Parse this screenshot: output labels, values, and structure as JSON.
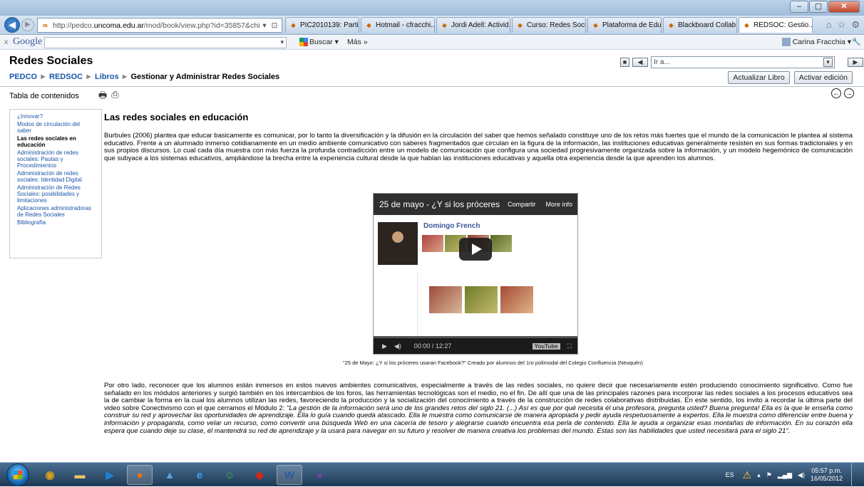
{
  "browser": {
    "address_url_path": "http://pedco.",
    "address_domain": "uncoma.edu.ar",
    "address_rest": "/mod/book/view.php?id=35857&chi",
    "address_controls": "▾ ⊡ C ✕",
    "tabs": [
      {
        "label": "PIC2010139: Partici...",
        "active": false
      },
      {
        "label": "Hotmail - cfracchi...",
        "active": false
      },
      {
        "label": "Jordi Adell: Activid...",
        "active": false
      },
      {
        "label": "Curso: Redes Social...",
        "active": false
      },
      {
        "label": "Plataforma de Edu...",
        "active": false
      },
      {
        "label": "Blackboard Collab...",
        "active": false
      },
      {
        "label": "REDSOC: Gestio...",
        "active": true
      }
    ]
  },
  "google_toolbar": {
    "logo": "Google",
    "buscar": "Buscar ▾",
    "mas": "Más »",
    "user": "Carina Fracchia ▾"
  },
  "page": {
    "site_name": "Redes Sociales",
    "jump_placeholder": "Ir a...",
    "breadcrumb": {
      "items": [
        "PEDCO",
        "REDSOC",
        "Libros"
      ],
      "separator": "►",
      "current": "Gestionar y Administrar Redes Sociales"
    },
    "buttons": {
      "update_book": "Actualizar Libro",
      "edit_mode": "Activar edición"
    },
    "toc_title": "Tabla de contenidos",
    "toc": [
      {
        "label": "¿Innovar?",
        "current": false
      },
      {
        "label": "Modos de circulación del saber",
        "current": false
      },
      {
        "label": "Las redes sociales en educación",
        "current": true
      },
      {
        "label": "Administración de redes sociales: Pautas y Procedimientos",
        "current": false
      },
      {
        "label": "Administración de redes sociales: Identidad Digital",
        "current": false
      },
      {
        "label": "Administración de Redes Sociales: posibilidades y limitaciones",
        "current": false
      },
      {
        "label": "Aplicaciones administradoras de Redes Sociales",
        "current": false
      },
      {
        "label": "Bibliografía",
        "current": false
      }
    ],
    "section_title": "Las redes sociales en educación",
    "paragraph1": "Burbules (2006) plantea que educar basicamente es comunicar, por lo tanto la diversificación y la difusión en la circulación del saber que hemos señalado constituye uno de los retos más fuertes que el mundo de la comunicación le plantea al sistema educativo. Frente a un alumnado inmerso cotidianamente en un medio ambiente comunicativo con saberes fragmentados que circulan en la figura de la información, las instituciones educativas generalmente resisten en sus formas tradicionales y en sus propios discursos. Lo cual cada día muestra con más fuerza la profunda contradicción entre un modelo de comunicación que configura una sociedad progresivamente organizada sobre la información, y un modelo hegemónico de comunicación que subyace a los sistemas educativos, ampliándose la brecha entre la experiencia cultural desde la que hablan las instituciones educativas y aquella otra experiencia desde la que aprenden los alumnos.",
    "video": {
      "title": "25 de mayo - ¿Y si los próceres...",
      "share": "Compartir",
      "more_info": "More info",
      "fb_name": "Domingo French",
      "time": "00:00 / 12:27",
      "yt": "YouTube"
    },
    "caption": "\"25 de Mayo: ¿Y si los próceres usaran Facebook?\" Creado por alumnos del 1ro polimodal del Colegio Confluencia (Neuquén)",
    "paragraph2_plain": "Por otro lado, reconocer que los alumnos están inmersos en estos nuevos ambientes comunicativos, especialmente a través de las redes sociales, no quiere decir que necesariamente estén produciendo conocimiento significativo. Como fue señalado en los módulos anteriores y surgió también en los intercambios de los foros, las herramientas tecnológicas son el medio, no el fin. De allí que una de las principales razones para incorporar las redes sociales a los procesos educativos sea la de cambiar la forma en la cual los alumnos utilizan las redes, favoreciendo la producción y la socialización del conocimiento a través de la construcción de redes colaborativas distribuidas. En este sentido, los invito a recordar la última parte del video sobre Conectivismo con el que cerramos el Módulo 2: ",
    "paragraph2_quote": "\"La gestión de la información será uno de los grandes retos del siglo 21. (...) Así es que por qué necesita él una profesora, pregunta usted? Buena pregunta! Ella es la que le enseña como construir su red y aprovechar las oportunidades de aprendizaje. Ella lo guía cuando queda atascado. Ella le muestra como comunicarse de manera apropiada y pedir ayuda respetuosamente a expertos. Ella le muestra como diferenciar entre buena y información y propaganda, como velar un recurso, como convertir una búsqueda Web en una cacería de tesoro y alegrarse cuando encuentra esa perla de contenido. Ella le ayuda a organizar esas montañas de información. En su corazón ella espera que cuando deje su clase, él mantendrá su red de aprendizaje y la usará para navegar en su futuro y resolver de manera creativa los problemas del mundo. Estas son las habilidades que usted necesitará para el siglo 21\"."
  },
  "taskbar": {
    "apps": [
      {
        "icon": "chrome-icon",
        "glyph": "◉",
        "color": "#d6a21e",
        "active": false
      },
      {
        "icon": "folder-icon",
        "glyph": "▬",
        "color": "#e8c36a",
        "active": false
      },
      {
        "icon": "media-player-icon",
        "glyph": "▶",
        "color": "#1f7fd0",
        "active": false
      },
      {
        "icon": "firefox-icon",
        "glyph": "●",
        "color": "#e8751a",
        "active": true
      },
      {
        "icon": "photo-icon",
        "glyph": "▲",
        "color": "#5aa0d8",
        "active": false
      },
      {
        "icon": "ie-icon",
        "glyph": "e",
        "color": "#3aa3f0",
        "active": false
      },
      {
        "icon": "messenger-icon",
        "glyph": "☺",
        "color": "#3db34a",
        "active": false
      },
      {
        "icon": "pdf-icon",
        "glyph": "◆",
        "color": "#d2261b",
        "active": false
      },
      {
        "icon": "word-icon",
        "glyph": "W",
        "color": "#2b5aa8",
        "active": true
      },
      {
        "icon": "visual-studio-icon",
        "glyph": "»",
        "color": "#8e3fb8",
        "active": false
      }
    ],
    "lang": "ES",
    "time": "05:57 p.m.",
    "date": "16/05/2012"
  }
}
